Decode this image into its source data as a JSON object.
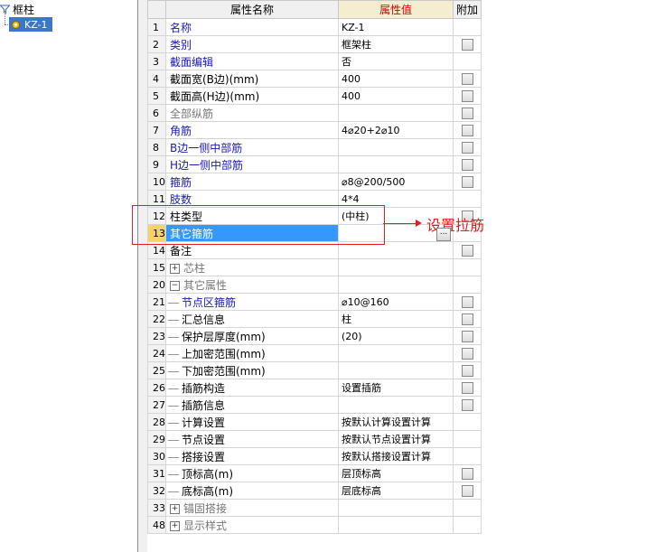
{
  "tree": {
    "root_label": "框柱",
    "child_label": "KZ-1"
  },
  "grid": {
    "headers": {
      "name": "属性名称",
      "value": "属性值",
      "extra": "附加"
    },
    "rows": [
      {
        "idx": "1",
        "name": "名称",
        "value": "KZ-1",
        "color": "blue",
        "checkbox": false
      },
      {
        "idx": "2",
        "name": "类别",
        "value": "框架柱",
        "color": "blue",
        "checkbox": true
      },
      {
        "idx": "3",
        "name": "截面编辑",
        "value": "否",
        "color": "blue",
        "checkbox": false
      },
      {
        "idx": "4",
        "name": "截面宽(B边)(mm)",
        "value": "400",
        "color": "black",
        "checkbox": true
      },
      {
        "idx": "5",
        "name": "截面高(H边)(mm)",
        "value": "400",
        "color": "black",
        "checkbox": true
      },
      {
        "idx": "6",
        "name": "全部纵筋",
        "value": "",
        "color": "gray",
        "checkbox": true
      },
      {
        "idx": "7",
        "name": "角筋",
        "value": "4⌀20+2⌀10",
        "color": "blue",
        "checkbox": true
      },
      {
        "idx": "8",
        "name": "B边一侧中部筋",
        "value": "",
        "color": "blue",
        "checkbox": true
      },
      {
        "idx": "9",
        "name": "H边一侧中部筋",
        "value": "",
        "color": "blue",
        "checkbox": true
      },
      {
        "idx": "10",
        "name": "箍筋",
        "value": "⌀8@200/500",
        "color": "blue",
        "checkbox": true
      },
      {
        "idx": "11",
        "name": "肢数",
        "value": "4*4",
        "color": "blue",
        "checkbox": false
      },
      {
        "idx": "12",
        "name": "柱类型",
        "value": "(中柱)",
        "color": "black",
        "checkbox": true
      },
      {
        "idx": "13",
        "name": "其它箍筋",
        "value": "",
        "color": "black",
        "checkbox": false,
        "selected": true
      },
      {
        "idx": "14",
        "name": "备注",
        "value": "",
        "color": "black",
        "checkbox": true
      },
      {
        "idx": "15",
        "name": "芯柱",
        "value": "",
        "color": "gray",
        "checkbox": false,
        "group": "+"
      },
      {
        "idx": "20",
        "name": "其它属性",
        "value": "",
        "color": "gray",
        "checkbox": false,
        "group": "−"
      },
      {
        "idx": "21",
        "name": "节点区箍筋",
        "value": "⌀10@160",
        "color": "blue",
        "checkbox": true,
        "child": true
      },
      {
        "idx": "22",
        "name": "汇总信息",
        "value": "柱",
        "color": "black",
        "checkbox": true,
        "child": true
      },
      {
        "idx": "23",
        "name": "保护层厚度(mm)",
        "value": "(20)",
        "color": "black",
        "checkbox": true,
        "child": true
      },
      {
        "idx": "24",
        "name": "上加密范围(mm)",
        "value": "",
        "color": "black",
        "checkbox": true,
        "child": true
      },
      {
        "idx": "25",
        "name": "下加密范围(mm)",
        "value": "",
        "color": "black",
        "checkbox": true,
        "child": true
      },
      {
        "idx": "26",
        "name": "插筋构造",
        "value": "设置插筋",
        "color": "black",
        "checkbox": true,
        "child": true
      },
      {
        "idx": "27",
        "name": "插筋信息",
        "value": "",
        "color": "black",
        "checkbox": true,
        "child": true
      },
      {
        "idx": "28",
        "name": "计算设置",
        "value": "按默认计算设置计算",
        "color": "black",
        "checkbox": false,
        "child": true
      },
      {
        "idx": "29",
        "name": "节点设置",
        "value": "按默认节点设置计算",
        "color": "black",
        "checkbox": false,
        "child": true
      },
      {
        "idx": "30",
        "name": "搭接设置",
        "value": "按默认搭接设置计算",
        "color": "black",
        "checkbox": false,
        "child": true
      },
      {
        "idx": "31",
        "name": "顶标高(m)",
        "value": "层顶标高",
        "color": "black",
        "checkbox": true,
        "child": true
      },
      {
        "idx": "32",
        "name": "底标高(m)",
        "value": "层底标高",
        "color": "black",
        "checkbox": true,
        "child": true
      },
      {
        "idx": "33",
        "name": "锚固搭接",
        "value": "",
        "color": "gray",
        "checkbox": false,
        "group": "+"
      },
      {
        "idx": "48",
        "name": "显示样式",
        "value": "",
        "color": "gray",
        "checkbox": false,
        "group": "+"
      }
    ]
  },
  "annotation": {
    "text": "设置拉筋",
    "color": "#e02020"
  },
  "ellipsis_button": "..."
}
